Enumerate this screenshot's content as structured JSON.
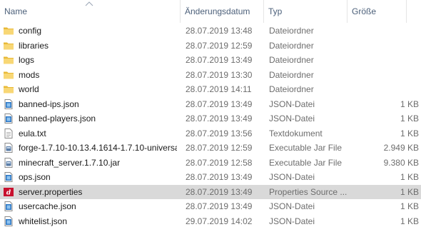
{
  "columns": {
    "name": "Name",
    "date": "Änderungsdatum",
    "type": "Typ",
    "size": "Größe"
  },
  "files": [
    {
      "name": "config",
      "date": "28.07.2019 13:48",
      "type": "Dateiordner",
      "size": "",
      "icon": "folder-icon"
    },
    {
      "name": "libraries",
      "date": "28.07.2019 12:59",
      "type": "Dateiordner",
      "size": "",
      "icon": "folder-icon"
    },
    {
      "name": "logs",
      "date": "28.07.2019 13:49",
      "type": "Dateiordner",
      "size": "",
      "icon": "folder-icon"
    },
    {
      "name": "mods",
      "date": "28.07.2019 13:30",
      "type": "Dateiordner",
      "size": "",
      "icon": "folder-icon"
    },
    {
      "name": "world",
      "date": "28.07.2019 14:11",
      "type": "Dateiordner",
      "size": "",
      "icon": "folder-icon"
    },
    {
      "name": "banned-ips.json",
      "date": "28.07.2019 13:49",
      "type": "JSON-Datei",
      "size": "1 KB",
      "icon": "json-file-icon"
    },
    {
      "name": "banned-players.json",
      "date": "28.07.2019 13:49",
      "type": "JSON-Datei",
      "size": "1 KB",
      "icon": "json-file-icon"
    },
    {
      "name": "eula.txt",
      "date": "28.07.2019 13:56",
      "type": "Textdokument",
      "size": "1 KB",
      "icon": "text-file-icon"
    },
    {
      "name": "forge-1.7.10-10.13.4.1614-1.7.10-universa...",
      "date": "28.07.2019 12:59",
      "type": "Executable Jar File",
      "size": "2.949 KB",
      "icon": "jar-file-icon"
    },
    {
      "name": "minecraft_server.1.7.10.jar",
      "date": "28.07.2019 12:58",
      "type": "Executable Jar File",
      "size": "9.380 KB",
      "icon": "jar-file-icon"
    },
    {
      "name": "ops.json",
      "date": "28.07.2019 13:49",
      "type": "JSON-Datei",
      "size": "1 KB",
      "icon": "json-file-icon"
    },
    {
      "name": "server.properties",
      "date": "28.07.2019 13:49",
      "type": "Properties Source ...",
      "size": "1 KB",
      "icon": "properties-file-icon",
      "selected": true
    },
    {
      "name": "usercache.json",
      "date": "28.07.2019 13:49",
      "type": "JSON-Datei",
      "size": "1 KB",
      "icon": "json-file-icon"
    },
    {
      "name": "whitelist.json",
      "date": "29.07.2019 14:02",
      "type": "JSON-Datei",
      "size": "1 KB",
      "icon": "json-file-icon"
    }
  ],
  "colors": {
    "header_text": "#4c607a",
    "detail_text": "#6d6d6d",
    "selected_row": "#d9d9d9",
    "folder": "#f5c542"
  }
}
